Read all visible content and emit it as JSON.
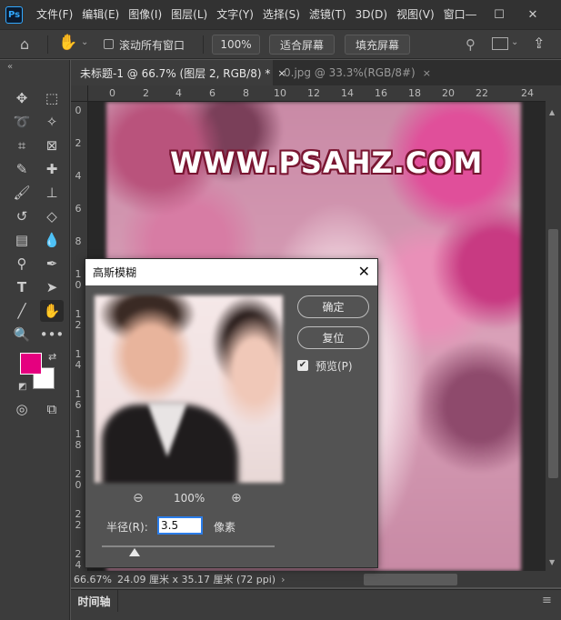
{
  "app": {
    "logo": "Ps"
  },
  "menu": [
    "文件(F)",
    "编辑(E)",
    "图像(I)",
    "图层(L)",
    "文字(Y)",
    "选择(S)",
    "滤镜(T)",
    "3D(D)",
    "视图(V)",
    "窗口"
  ],
  "options": {
    "scroll_all_label": "滚动所有窗口",
    "zoom_value": "100%",
    "fit_screen": "适合屏幕",
    "fill_screen": "填充屏幕"
  },
  "tabs": [
    {
      "label": "未标题-1 @ 66.7% (图层 2, RGB/8) *",
      "close": "×"
    },
    {
      "label": "0.jpg @ 33.3%(RGB/8#)",
      "close": "×"
    }
  ],
  "ruler": {
    "h_ticks": [
      "0",
      "2",
      "4",
      "6",
      "8",
      "10",
      "12",
      "14",
      "16",
      "18",
      "20",
      "22",
      "24"
    ],
    "v_ticks": [
      "0",
      "2",
      "4",
      "6",
      "8",
      "10",
      "12",
      "14",
      "16",
      "18",
      "20",
      "22",
      "24"
    ]
  },
  "canvas": {
    "watermark": "WWW.PSAHZ.COM"
  },
  "colors": {
    "foreground": "#e5007f",
    "background": "#ffffff"
  },
  "status": {
    "zoom": "66.67%",
    "doc_size": "24.09 厘米 x 35.17 厘米 (72 ppi)",
    "arrow": "›"
  },
  "timeline": {
    "label": "时间轴"
  },
  "dialog": {
    "title": "高斯模糊",
    "ok": "确定",
    "reset": "复位",
    "preview_label": "预览(P)",
    "preview_checked": true,
    "zoom": "100%",
    "radius_label": "半径(R):",
    "radius_value": "3.5",
    "radius_unit": "像素"
  }
}
